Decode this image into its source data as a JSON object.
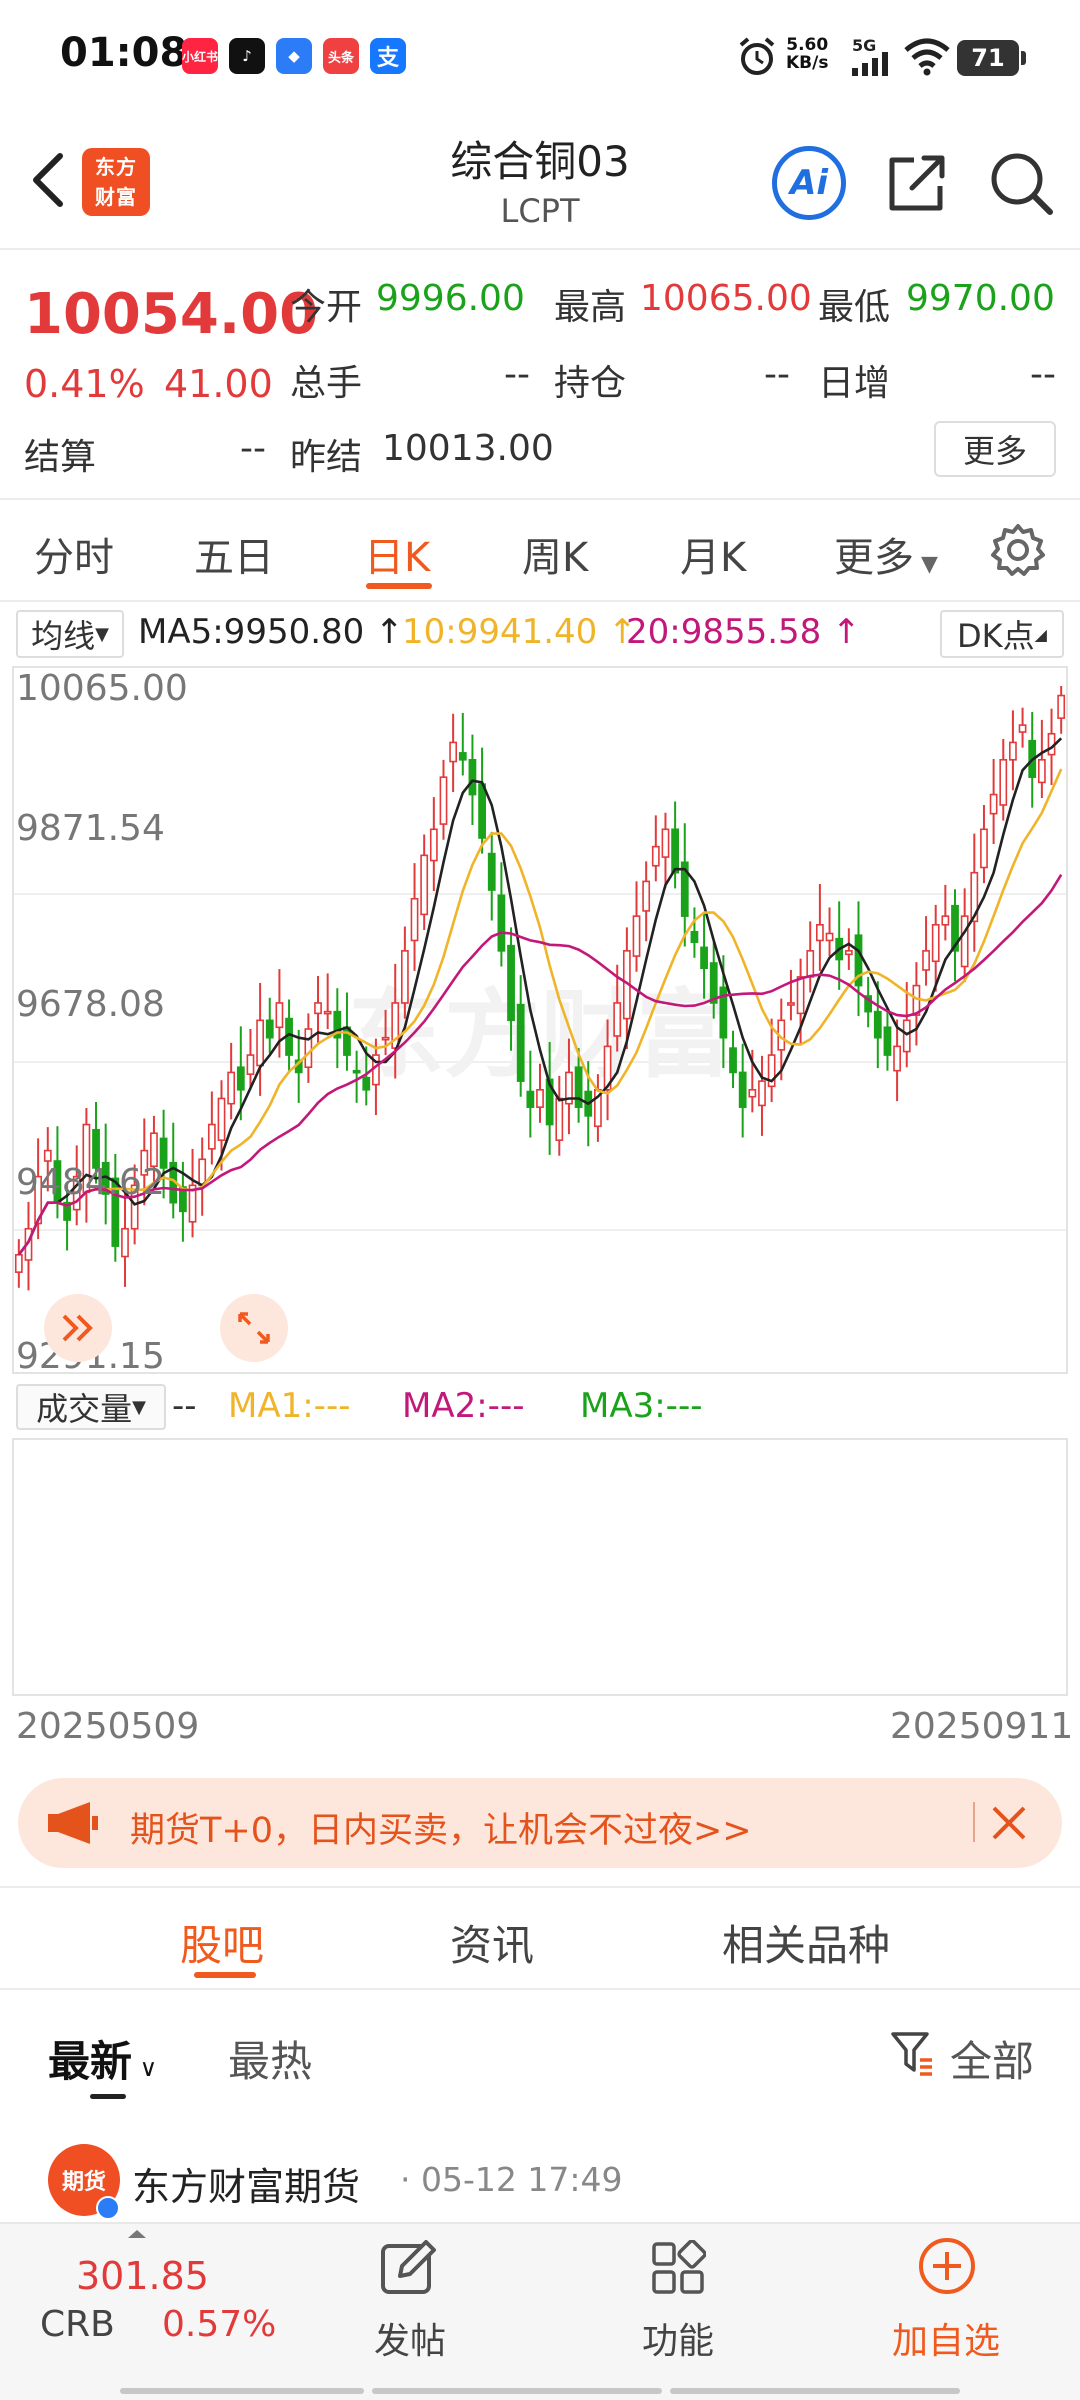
{
  "status_bar": {
    "time": "01:08",
    "apps": [
      {
        "label": "小红书",
        "color": "#ff2442"
      },
      {
        "label": "♪",
        "color": "#111111"
      },
      {
        "label": "◆",
        "color": "#2b7cf6"
      },
      {
        "label": "头条",
        "color": "#f04142"
      },
      {
        "label": "支",
        "color": "#1677ff"
      }
    ],
    "net_speed_value": "5.60",
    "net_speed_unit": "KB/s",
    "network": "5G",
    "battery": "71"
  },
  "header": {
    "logo_line1": "东方",
    "logo_line2": "财富",
    "title": "综合铜03",
    "subtitle": "LCPT",
    "ai_label": "Ai"
  },
  "quote": {
    "price": "10054.00",
    "change_pct": "0.41%",
    "change_abs": "41.00",
    "open_label": "今开",
    "open_value": "9996.00",
    "high_label": "最高",
    "high_value": "10065.00",
    "low_label": "最低",
    "low_value": "9970.00",
    "volume_label": "总手",
    "volume_value": "--",
    "position_label": "持仓",
    "position_value": "--",
    "daily_inc_label": "日增",
    "daily_inc_value": "--",
    "settle_label": "结算",
    "settle_value": "--",
    "prev_settle_label": "昨结",
    "prev_settle_value": "10013.00",
    "more_label": "更多"
  },
  "chart_tabs": [
    "分时",
    "五日",
    "日K",
    "周K",
    "月K",
    "更多"
  ],
  "chart_header": {
    "indicator": "均线",
    "ma5": "MA5:9950.80",
    "ma10": "10:9941.40",
    "ma20": "20:9855.58",
    "dk_label": "DK点"
  },
  "chart_data": {
    "type": "candlestick",
    "y_ticks": [
      "10065.00",
      "9871.54",
      "9678.08",
      "9484.62",
      "9291.15"
    ],
    "ylim": [
      9291.15,
      10065.0
    ],
    "x_start": "20250509",
    "x_end": "20250911",
    "watermark": "东方财富",
    "ma_colors": {
      "ma5": "#222222",
      "ma10": "#f0b429",
      "ma20": "#c2187a"
    },
    "closes": [
      9410,
      9440,
      9500,
      9530,
      9470,
      9450,
      9500,
      9560,
      9510,
      9480,
      9420,
      9440,
      9490,
      9530,
      9550,
      9510,
      9470,
      9460,
      9490,
      9520,
      9560,
      9590,
      9620,
      9600,
      9640,
      9680,
      9660,
      9700,
      9640,
      9620,
      9670,
      9700,
      9690,
      9660,
      9640,
      9620,
      9600,
      9640,
      9660,
      9700,
      9760,
      9820,
      9870,
      9900,
      9960,
      10000,
      9980,
      9940,
      9890,
      9830,
      9760,
      9680,
      9610,
      9580,
      9600,
      9560,
      9590,
      9620,
      9580,
      9570,
      9600,
      9650,
      9700,
      9760,
      9800,
      9840,
      9880,
      9900,
      9850,
      9800,
      9770,
      9740,
      9700,
      9660,
      9620,
      9580,
      9600,
      9610,
      9640,
      9680,
      9700,
      9730,
      9760,
      9790,
      9780,
      9750,
      9760,
      9720,
      9690,
      9660,
      9640,
      9650,
      9680,
      9720,
      9760,
      9790,
      9800,
      9760,
      9800,
      9850,
      9900,
      9940,
      9980,
      10000,
      10020,
      9960,
      9980,
      10010,
      10054
    ],
    "volume_header": {
      "label": "成交量",
      "dash": "--",
      "ma1": "MA1:---",
      "ma2": "MA2:---",
      "ma3": "MA3:---"
    }
  },
  "promo": {
    "text": "期货T+0，日内买卖，让机会不过夜>>"
  },
  "content_tabs": [
    "股吧",
    "资讯",
    "相关品种"
  ],
  "filter": {
    "latest": "最新",
    "hot": "最热",
    "all": "全部"
  },
  "post": {
    "avatar_text": "期货",
    "author": "东方财富期货",
    "time": "· 05-12 17:49"
  },
  "bottom_nav": {
    "crb_value": "301.85",
    "crb_name": "CRB",
    "crb_change": "0.57%",
    "post_label": "发帖",
    "function_label": "功能",
    "add_watch_label": "加自选"
  }
}
